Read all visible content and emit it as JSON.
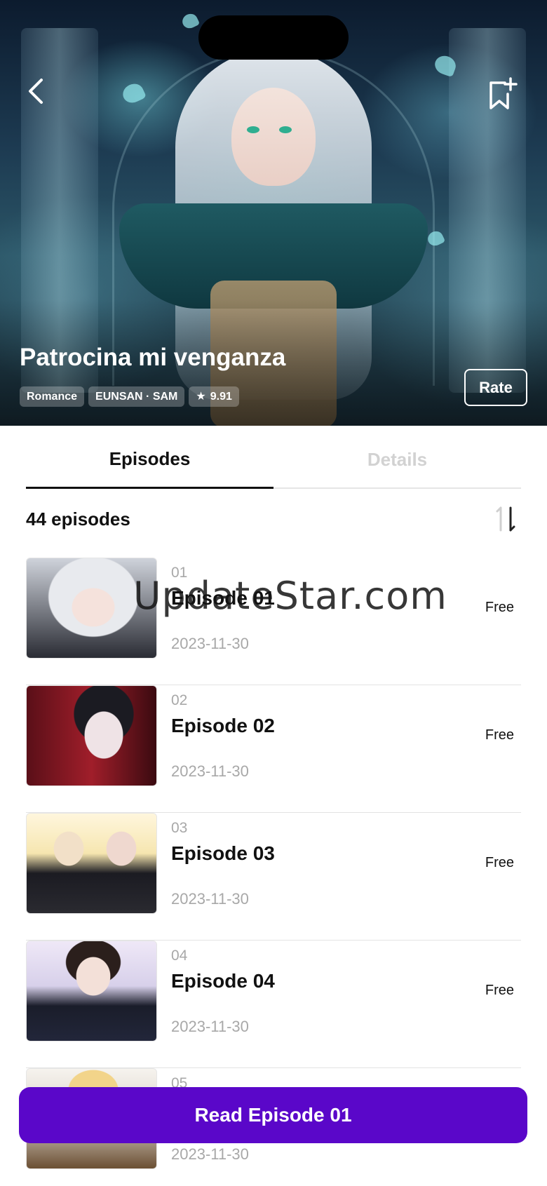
{
  "hero": {
    "title": "Patrocina mi venganza",
    "tags": [
      "Romance",
      "EUNSAN · SAM"
    ],
    "rating": "9.91",
    "rate_label": "Rate"
  },
  "tabs": [
    "Episodes",
    "Details"
  ],
  "episode_count": "44 episodes",
  "episodes": [
    {
      "num": "01",
      "title": "Episode 01",
      "date": "2023-11-30",
      "price": "Free"
    },
    {
      "num": "02",
      "title": "Episode 02",
      "date": "2023-11-30",
      "price": "Free"
    },
    {
      "num": "03",
      "title": "Episode 03",
      "date": "2023-11-30",
      "price": "Free"
    },
    {
      "num": "04",
      "title": "Episode 04",
      "date": "2023-11-30",
      "price": "Free"
    },
    {
      "num": "05",
      "title": "",
      "date": "2023-11-30",
      "price": ""
    }
  ],
  "watermark": "UpdateStar.com",
  "cta_label": "Read Episode 01",
  "colors": {
    "accent": "#5a07c9",
    "muted": "#a8a8a8",
    "tab_inactive": "#d2d2d2"
  },
  "icons": {
    "back": "chevron-left-icon",
    "bookmark": "bookmark-add-icon",
    "sort": "sort-icon",
    "star": "star-icon"
  }
}
